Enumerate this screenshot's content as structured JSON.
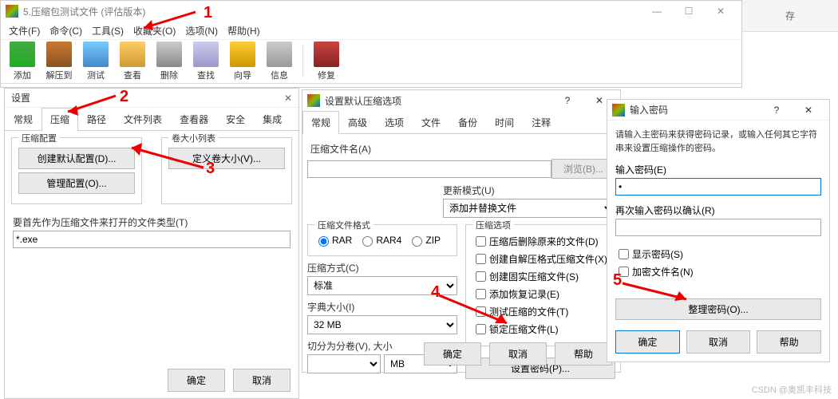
{
  "main": {
    "title": "5.压缩包测试文件 (评估版本)",
    "menu": [
      "文件(F)",
      "命令(C)",
      "工具(S)",
      "收藏夹(O)",
      "选项(N)",
      "帮助(H)"
    ],
    "toolbar": [
      {
        "label": "添加",
        "cls": "ico-add"
      },
      {
        "label": "解压到",
        "cls": "ico-ext"
      },
      {
        "label": "测试",
        "cls": "ico-test"
      },
      {
        "label": "查看",
        "cls": "ico-view"
      },
      {
        "label": "删除",
        "cls": "ico-del"
      },
      {
        "label": "查找",
        "cls": "ico-find"
      },
      {
        "label": "向导",
        "cls": "ico-wiz"
      },
      {
        "label": "信息",
        "cls": "ico-info"
      },
      {
        "label": "修复",
        "cls": "ico-rep"
      }
    ]
  },
  "rside": {
    "label": "存"
  },
  "settings": {
    "title": "设置",
    "tabs": [
      "常规",
      "压缩",
      "路径",
      "文件列表",
      "查看器",
      "安全",
      "集成"
    ],
    "active": 1,
    "group_compress": "压缩配置",
    "btn_create": "创建默认配置(D)...",
    "btn_manage": "管理配置(O)...",
    "group_vol": "卷大小列表",
    "btn_vol": "定义卷大小(V)...",
    "prefer_label": "要首先作为压缩文件来打开的文件类型(T)",
    "prefer_value": "*.exe",
    "ok": "确定",
    "cancel": "取消"
  },
  "defaults": {
    "title": "设置默认压缩选项",
    "tabs": [
      "常规",
      "高级",
      "选项",
      "文件",
      "备份",
      "时间",
      "注释"
    ],
    "active": 0,
    "name_label": "压缩文件名(A)",
    "browse": "浏览(B)...",
    "update_label": "更新模式(U)",
    "update_value": "添加并替换文件",
    "format_label": "压缩文件格式",
    "opts_label": "压缩选项",
    "radios": [
      "RAR",
      "RAR4",
      "ZIP"
    ],
    "radio_checked": 0,
    "checks": [
      "压缩后删除原来的文件(D)",
      "创建自解压格式压缩文件(X)",
      "创建固实压缩文件(S)",
      "添加恢复记录(E)",
      "测试压缩的文件(T)",
      "锁定压缩文件(L)"
    ],
    "method_label": "压缩方式(C)",
    "method_value": "标准",
    "dict_label": "字典大小(I)",
    "dict_value": "32 MB",
    "split_label": "切分为分卷(V), 大小",
    "split_unit": "MB",
    "setpwd": "设置密码(P)...",
    "ok": "确定",
    "cancel": "取消",
    "help": "帮助"
  },
  "pwd": {
    "title": "输入密码",
    "msg": "请输入主密码来获得密码记录，或输入任何其它字符串来设置压缩操作的密码。",
    "pwd_label": "输入密码(E)",
    "pwd_value": "•",
    "confirm_label": "再次输入密码以确认(R)",
    "show": "显示密码(S)",
    "encrypt": "加密文件名(N)",
    "organize": "整理密码(O)...",
    "ok": "确定",
    "cancel": "取消",
    "help": "帮助"
  },
  "annots": {
    "1": "1",
    "2": "2",
    "3": "3",
    "4": "4",
    "5": "5"
  },
  "watermark": "CSDN @奥凯丰科技"
}
